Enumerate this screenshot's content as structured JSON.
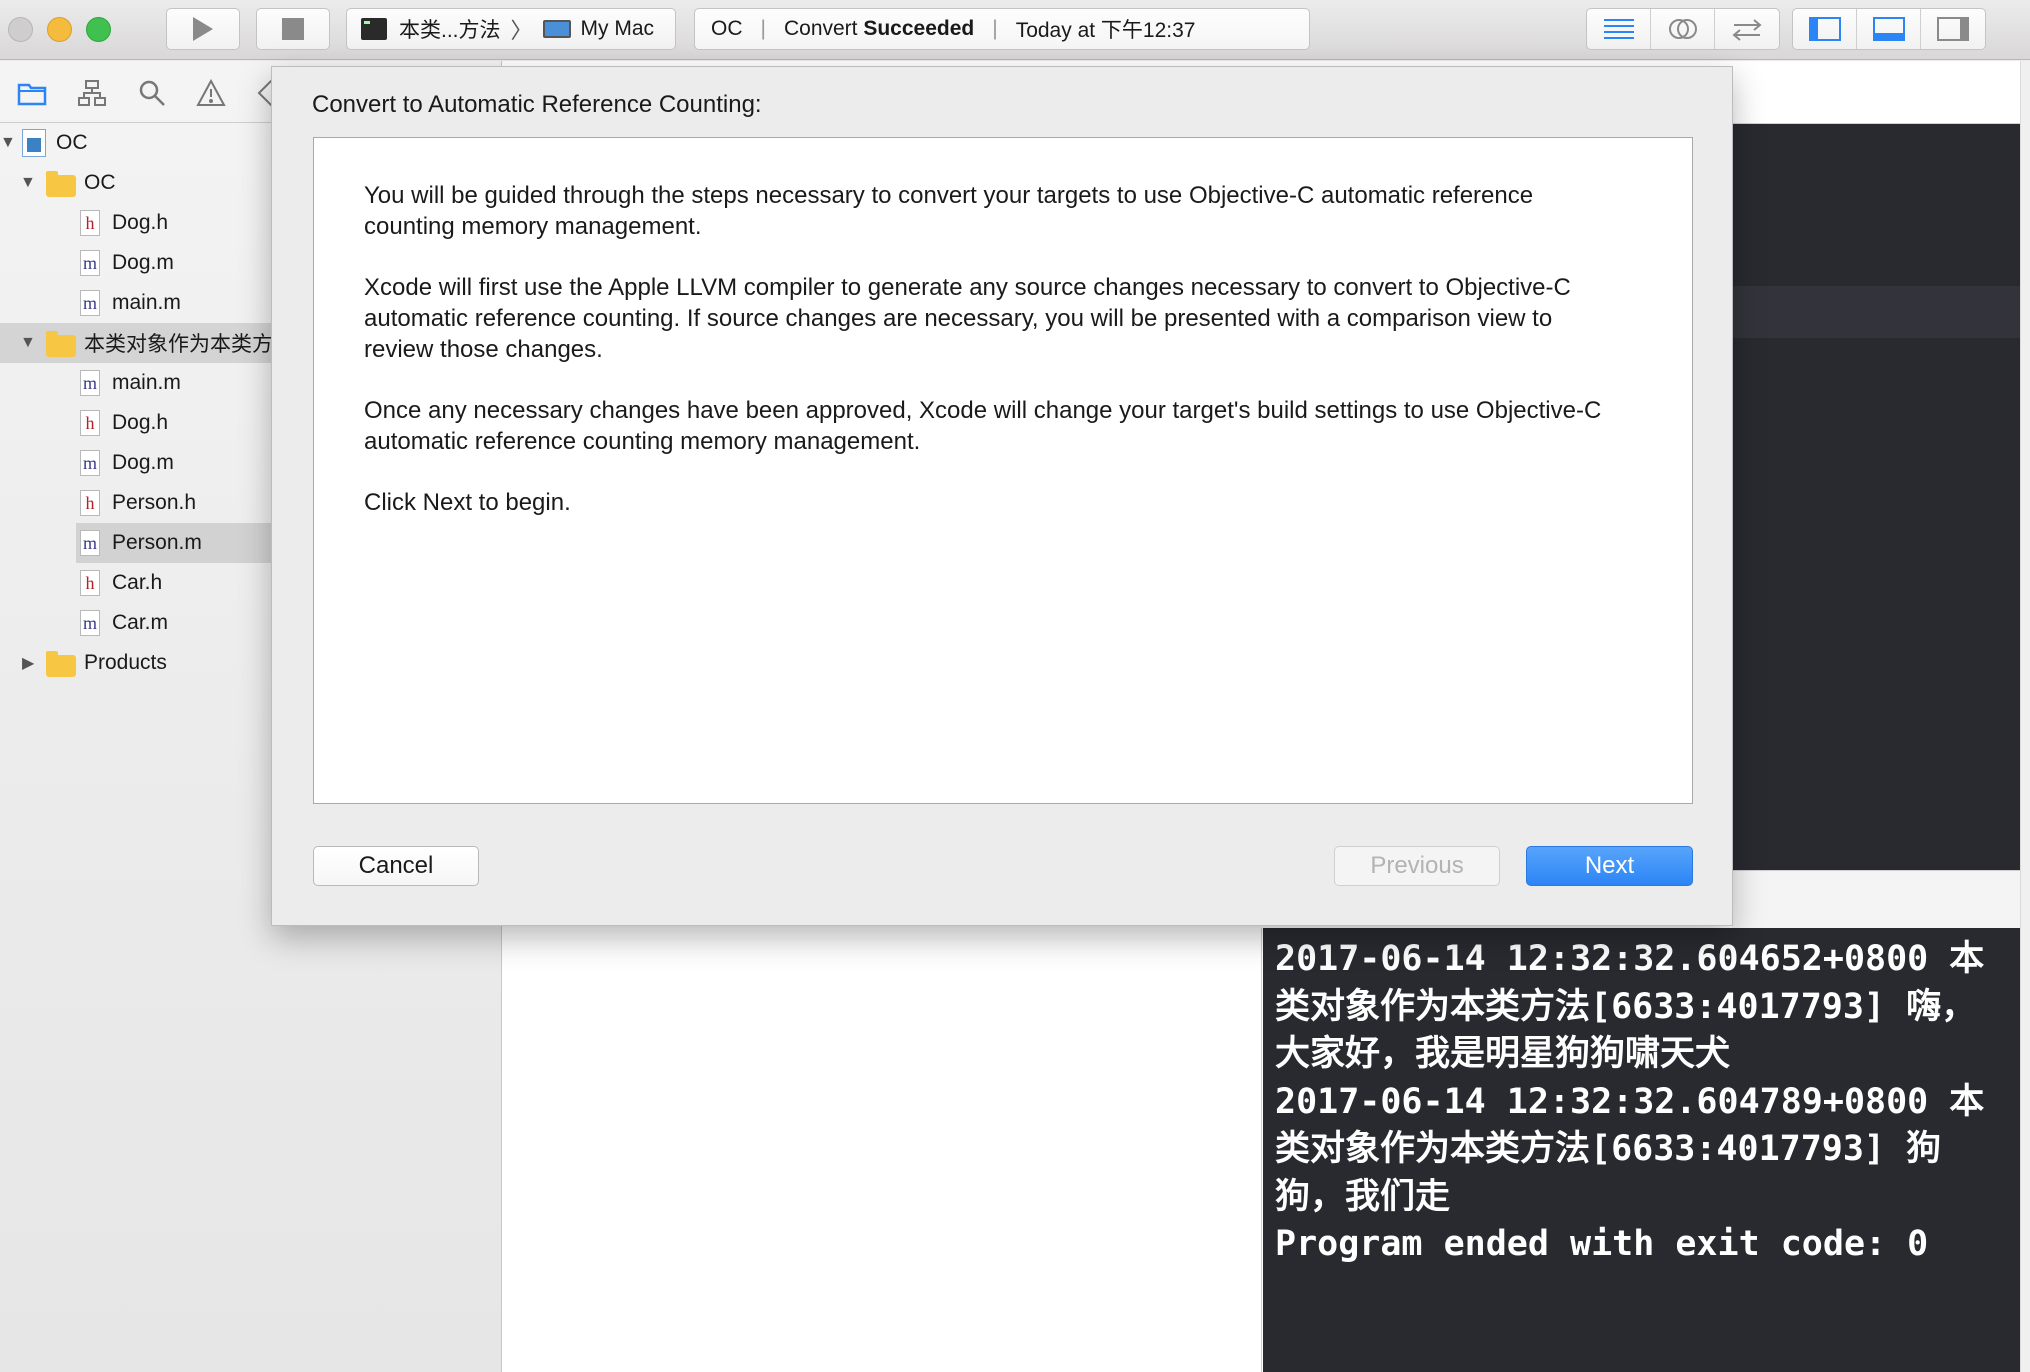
{
  "toolbar": {
    "scheme_name": "本类...方法",
    "destination": "My Mac",
    "activity": {
      "project": "OC",
      "status_prefix": "Convert",
      "status_word": "Succeeded",
      "time": "Today at 下午12:37"
    }
  },
  "navigator": {
    "tree": [
      {
        "label": "OC",
        "kind": "project"
      },
      {
        "label": "OC",
        "kind": "group"
      },
      {
        "label": "Dog.h",
        "kind": "h"
      },
      {
        "label": "Dog.m",
        "kind": "m"
      },
      {
        "label": "main.m",
        "kind": "m"
      },
      {
        "label": "本类对象作为本类方法",
        "kind": "group"
      },
      {
        "label": "main.m",
        "kind": "m"
      },
      {
        "label": "Dog.h",
        "kind": "h"
      },
      {
        "label": "Dog.m",
        "kind": "m"
      },
      {
        "label": "Person.h",
        "kind": "h"
      },
      {
        "label": "Person.m",
        "kind": "m"
      },
      {
        "label": "Car.h",
        "kind": "h"
      },
      {
        "label": "Car.m",
        "kind": "m"
      },
      {
        "label": "Products",
        "kind": "group"
      }
    ],
    "file_glyphs": {
      "h": "h",
      "m": "m"
    }
  },
  "dialog": {
    "title": "Convert to Automatic Reference Counting:",
    "paragraphs": [
      "You will be guided through the steps necessary to convert your targets to use Objective-C automatic reference counting memory management.",
      "Xcode will first use the Apple LLVM compiler to generate any source changes necessary to convert to Objective-C automatic reference counting. If source changes are necessary, you will be presented with a comparison view to review those changes.",
      "Once any necessary changes have been approved, Xcode will change your target's build settings to use Objective-C automatic reference counting memory management.",
      "Click Next to begin."
    ],
    "buttons": {
      "cancel": "Cancel",
      "previous": "Previous",
      "next": "Next"
    }
  },
  "console": {
    "lines": [
      "2017-06-14 12:32:32.604652+0800 本类对象作为本类方法[6633:4017793] 嗨，大家好，我是明星狗狗啸天犬",
      "2017-06-14 12:32:32.604789+0800 本类对象作为本类方法[6633:4017793] 狗狗，我们走",
      "Program ended with exit code: 0"
    ]
  },
  "colors": {
    "accent": "#2c85f5",
    "console_bg": "#292a30",
    "h_file": "#b0222a",
    "m_file": "#3a3a8c",
    "folder": "#f7c744"
  }
}
